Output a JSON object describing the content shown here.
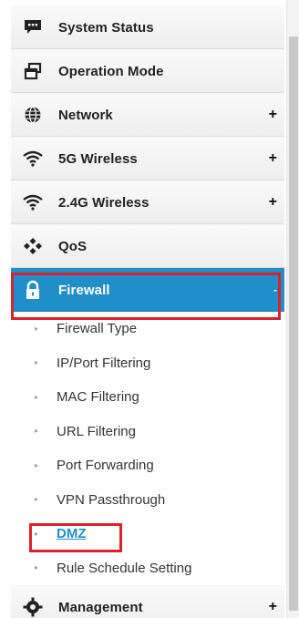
{
  "menu": {
    "items": [
      {
        "label": "System Status",
        "icon": "chat-bubble-icon",
        "expand": ""
      },
      {
        "label": "Operation Mode",
        "icon": "windows-icon",
        "expand": ""
      },
      {
        "label": "Network",
        "icon": "globe-icon",
        "expand": "+"
      },
      {
        "label": "5G Wireless",
        "icon": "wifi-icon",
        "expand": "+"
      },
      {
        "label": "2.4G Wireless",
        "icon": "wifi-icon",
        "expand": "+"
      },
      {
        "label": "QoS",
        "icon": "qos-icon",
        "expand": ""
      },
      {
        "label": "Firewall",
        "icon": "lock-icon",
        "expand": "-"
      }
    ],
    "firewall_submenu": [
      {
        "label": "Firewall Type"
      },
      {
        "label": "IP/Port Filtering"
      },
      {
        "label": "MAC Filtering"
      },
      {
        "label": "URL Filtering"
      },
      {
        "label": "Port Forwarding"
      },
      {
        "label": "VPN Passthrough"
      },
      {
        "label": "DMZ"
      },
      {
        "label": "Rule Schedule Setting"
      }
    ],
    "bottom_item": {
      "label": "Management",
      "icon": "gear-icon",
      "expand": "+"
    }
  },
  "colors": {
    "active_bg": "#1f8ec9",
    "highlight_box": "#d8222e",
    "selected_text": "#1f8ec9"
  }
}
